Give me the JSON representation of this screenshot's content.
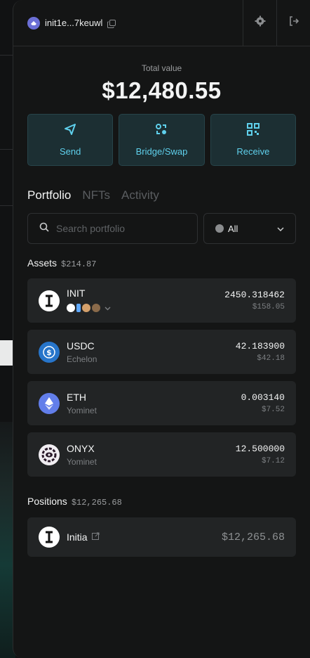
{
  "header": {
    "address": "init1e...7keuwl"
  },
  "total": {
    "label": "Total value",
    "value": "$12,480.55"
  },
  "actions": [
    {
      "label": "Send",
      "icon": "send-icon"
    },
    {
      "label": "Bridge/Swap",
      "icon": "bridge-swap-icon"
    },
    {
      "label": "Receive",
      "icon": "qr-code-icon"
    }
  ],
  "tabs": [
    "Portfolio",
    "NFTs",
    "Activity"
  ],
  "search": {
    "placeholder": "Search portfolio"
  },
  "chain_filter": {
    "selected": "All"
  },
  "assets": {
    "title": "Assets",
    "total": "$214.87",
    "items": [
      {
        "symbol": "INIT",
        "sub": "",
        "amount": "2450.318462",
        "usd": "$158.05"
      },
      {
        "symbol": "USDC",
        "sub": "Echelon",
        "amount": "42.183900",
        "usd": "$42.18"
      },
      {
        "symbol": "ETH",
        "sub": "Yominet",
        "amount": "0.003140",
        "usd": "$7.52"
      },
      {
        "symbol": "ONYX",
        "sub": "Yominet",
        "amount": "12.500000",
        "usd": "$7.12"
      }
    ]
  },
  "positions": {
    "title": "Positions",
    "total": "$12,265.68",
    "items": [
      {
        "name": "Initia",
        "value": "$12,265.68"
      }
    ]
  },
  "colors": {
    "accent": "#5fd0ec",
    "action_bg": "#1c2f33",
    "panel": "#141515"
  }
}
